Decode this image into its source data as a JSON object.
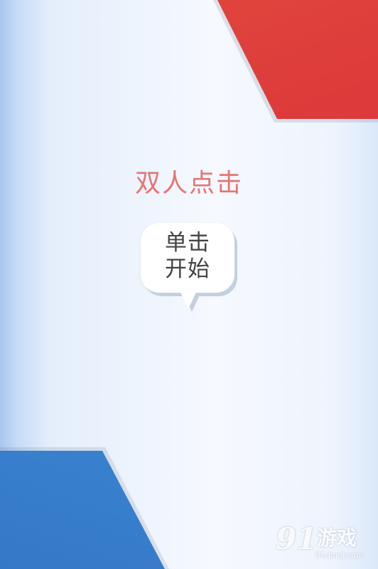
{
  "screen": {
    "title": "双人点击",
    "start_button": {
      "line1": "单击",
      "line2": "开始"
    }
  },
  "watermark": {
    "logo": "91",
    "name": "游戏",
    "site": "91danji.com"
  },
  "colors": {
    "title": "#e77474",
    "red_panel": "#d82f3a",
    "blue_panel": "#3d86d2",
    "background": "#f6f9fe"
  }
}
